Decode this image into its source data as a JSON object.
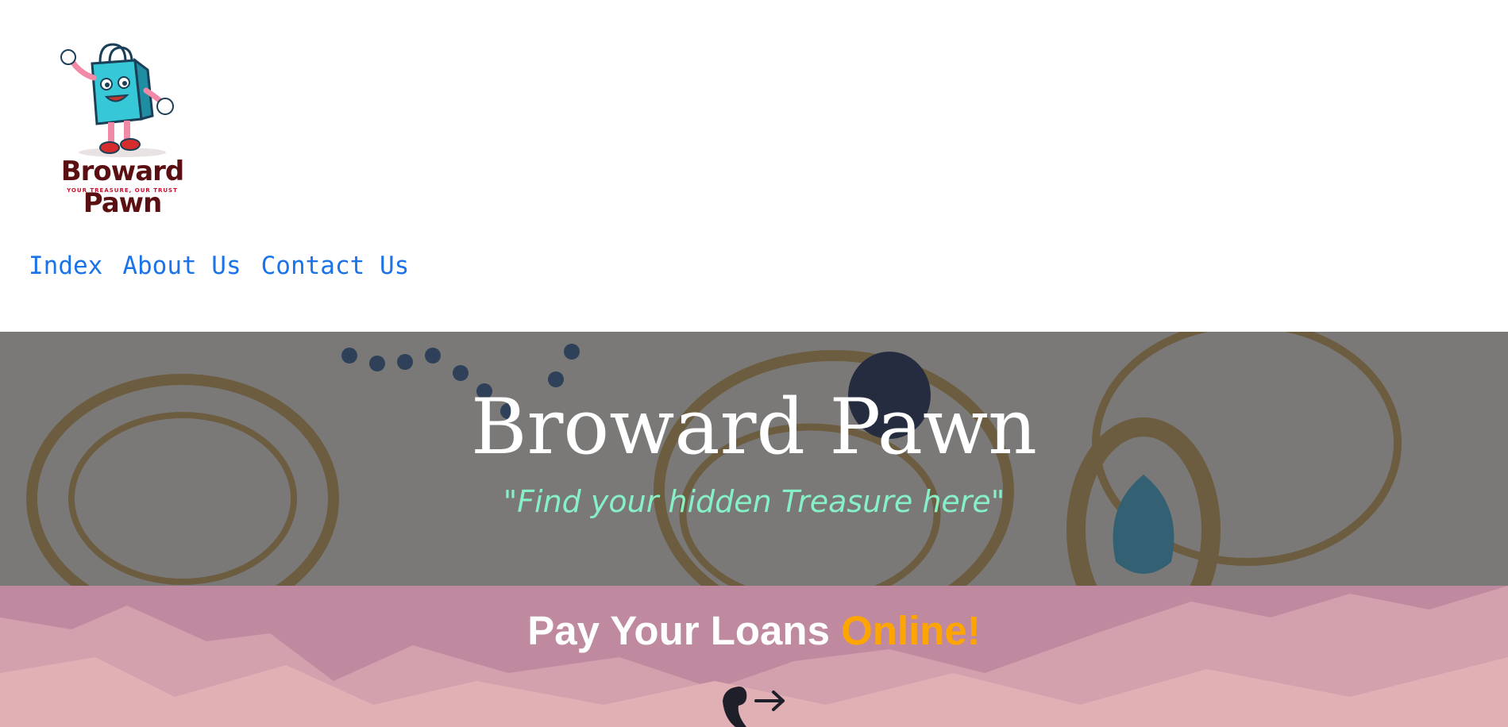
{
  "logo": {
    "name": "Broward Pawn",
    "tagline": "YOUR TREASURE, OUR TRUST",
    "icon": "shopping-bag-mascot"
  },
  "nav": {
    "items": [
      {
        "label": "Index"
      },
      {
        "label": "About Us"
      },
      {
        "label": "Contact Us"
      }
    ]
  },
  "hero": {
    "title": "Broward Pawn",
    "subtitle": "\"Find your hidden Treasure here\"",
    "background": "rings-jewelry-photo"
  },
  "promo": {
    "title_prefix": "Pay Your Loans ",
    "title_highlight": "Online!",
    "icon": "phone-arrow-icon"
  },
  "colors": {
    "nav_link": "#1a73e8",
    "subtitle": "#86f0c6",
    "highlight": "#ffa500",
    "promo_bg": "#c48da0",
    "logo_text": "#5a0f12"
  }
}
